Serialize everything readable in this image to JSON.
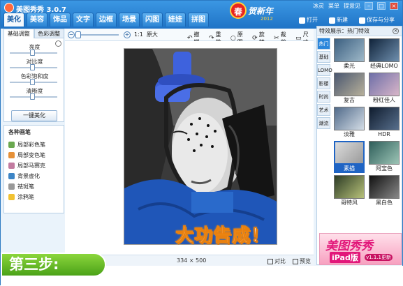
{
  "app": {
    "title": "美图秀秀 3.0.7"
  },
  "tabs": [
    {
      "label": "美化",
      "active": true
    },
    {
      "label": "美容"
    },
    {
      "label": "饰品"
    },
    {
      "label": "文字"
    },
    {
      "label": "边框"
    },
    {
      "label": "场景"
    },
    {
      "label": "闪图"
    },
    {
      "label": "娃娃"
    },
    {
      "label": "拼图"
    }
  ],
  "promo": {
    "badge": "春",
    "title": "贺新年",
    "year": "2012"
  },
  "topright": {
    "user": "冰灵",
    "menu": "菜单",
    "feedback": "提意见"
  },
  "actions": {
    "open": "打开",
    "new": "新建",
    "save": "保存与分享"
  },
  "toolbar": {
    "zoom_ratio": "1:1",
    "original": "原大",
    "undo": "撤销",
    "redo": "重做",
    "source": "原图",
    "rotate": "旋转",
    "crop": "裁剪",
    "resize": "尺寸"
  },
  "left_panel": {
    "tabs": [
      "基础调整",
      "色彩调整"
    ],
    "sliders": [
      "亮度",
      "对比度",
      "色彩饱和度",
      "清晰度"
    ],
    "one_key": "一键美化",
    "brush_title": "各种画笔",
    "brushes": [
      {
        "label": "局部彩色笔",
        "color": "#6aa84f"
      },
      {
        "label": "局部变色笔",
        "color": "#e69138"
      },
      {
        "label": "局部马赛克",
        "color": "#c27ba0"
      },
      {
        "label": "背景虚化",
        "color": "#3d85c6"
      },
      {
        "label": "祛斑笔",
        "color": "#999999"
      },
      {
        "label": "涂鸦笔",
        "color": "#f1c232"
      }
    ]
  },
  "status": {
    "dims": "334 × 500",
    "compare": "对比",
    "preview": "预览"
  },
  "right_panel": {
    "header": "特效展示：热门特效",
    "categories": [
      "热门",
      "基础",
      "LOMO",
      "影楼",
      "时尚",
      "艺术",
      "潮流"
    ],
    "effects": [
      {
        "label": "柔光"
      },
      {
        "label": "经典LOMO"
      },
      {
        "label": "复古"
      },
      {
        "label": "粉红佳人"
      },
      {
        "label": "淡雅"
      },
      {
        "label": "HDR"
      },
      {
        "label": "素描",
        "selected": true
      },
      {
        "label": "阿宝色"
      },
      {
        "label": "哥特风"
      },
      {
        "label": "黑白色"
      }
    ]
  },
  "ad": {
    "title": "美图秀秀",
    "subtitle": "iPad版",
    "version": "v1.1.1更新"
  },
  "overlay": "大功告成！",
  "step": "第三步:"
}
